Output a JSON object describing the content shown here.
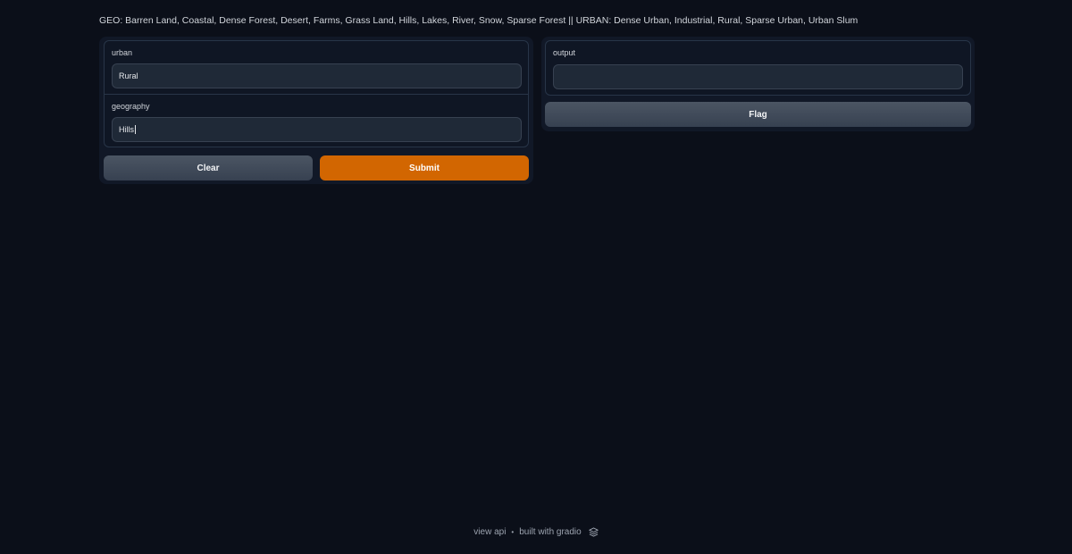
{
  "description": "GEO: Barren Land, Coastal, Dense Forest, Desert, Farms, Grass Land, Hills, Lakes, River, Snow, Sparse Forest || URBAN: Dense Urban, Industrial, Rural, Sparse Urban, Urban Slum",
  "inputs": {
    "urban": {
      "label": "urban",
      "value": "Rural"
    },
    "geography": {
      "label": "geography",
      "value": "Hills"
    }
  },
  "outputs": {
    "output": {
      "label": "output",
      "value": ""
    }
  },
  "buttons": {
    "clear": "Clear",
    "submit": "Submit",
    "flag": "Flag"
  },
  "footer": {
    "view_api": "view api",
    "separator": "•",
    "built_with": "built with gradio",
    "logo_icon": "gradio-logo-icon"
  },
  "colors": {
    "background": "#0b0f19",
    "primary_button": "#d26601",
    "secondary_button": "#4b5563"
  }
}
